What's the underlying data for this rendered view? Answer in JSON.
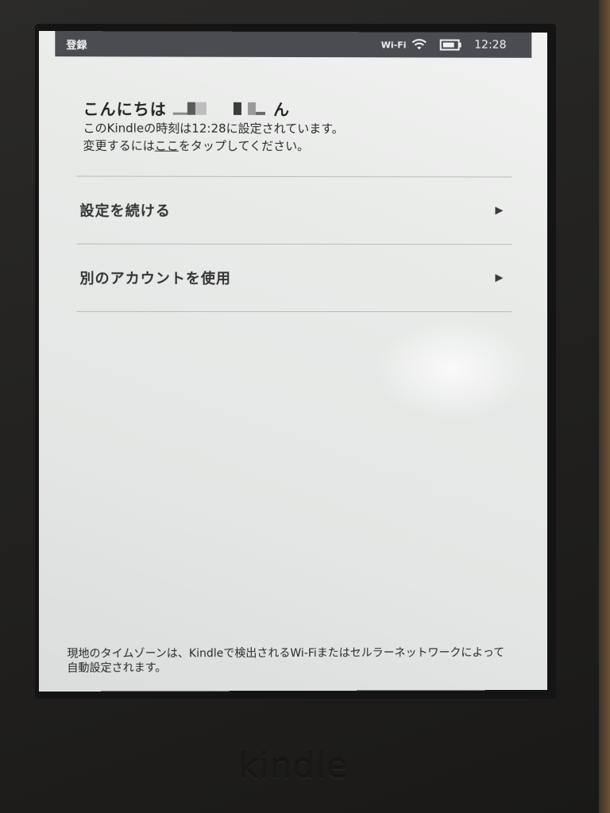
{
  "statusbar": {
    "title": "登録",
    "wifi_label": "Wi-Fi",
    "wifi_icon": "wifi-icon",
    "battery_icon": "battery-icon",
    "clock": "12:28"
  },
  "greeting": {
    "hello_prefix": "こんにちは",
    "hello_suffix": "ん",
    "time_line": "このKindleの時刻は12:28に設定されています。",
    "change_prefix": "変更するには",
    "change_link": "ここ",
    "change_suffix": "をタップしてください。"
  },
  "menu": {
    "items": [
      {
        "label": "設定を続ける",
        "arrow_icon": "play-arrow-icon"
      },
      {
        "label": "別のアカウントを使用",
        "arrow_icon": "play-arrow-icon"
      }
    ]
  },
  "footer": {
    "note": "現地のタイムゾーンは、Kindleで検出されるWi-Fiまたはセルラーネットワークによって自動設定されます。"
  },
  "device": {
    "logo": "kindle"
  },
  "colors": {
    "statusbar_bg": "#4a4c52",
    "screen_bg": "#e9ebe9",
    "bezel": "#232220"
  }
}
